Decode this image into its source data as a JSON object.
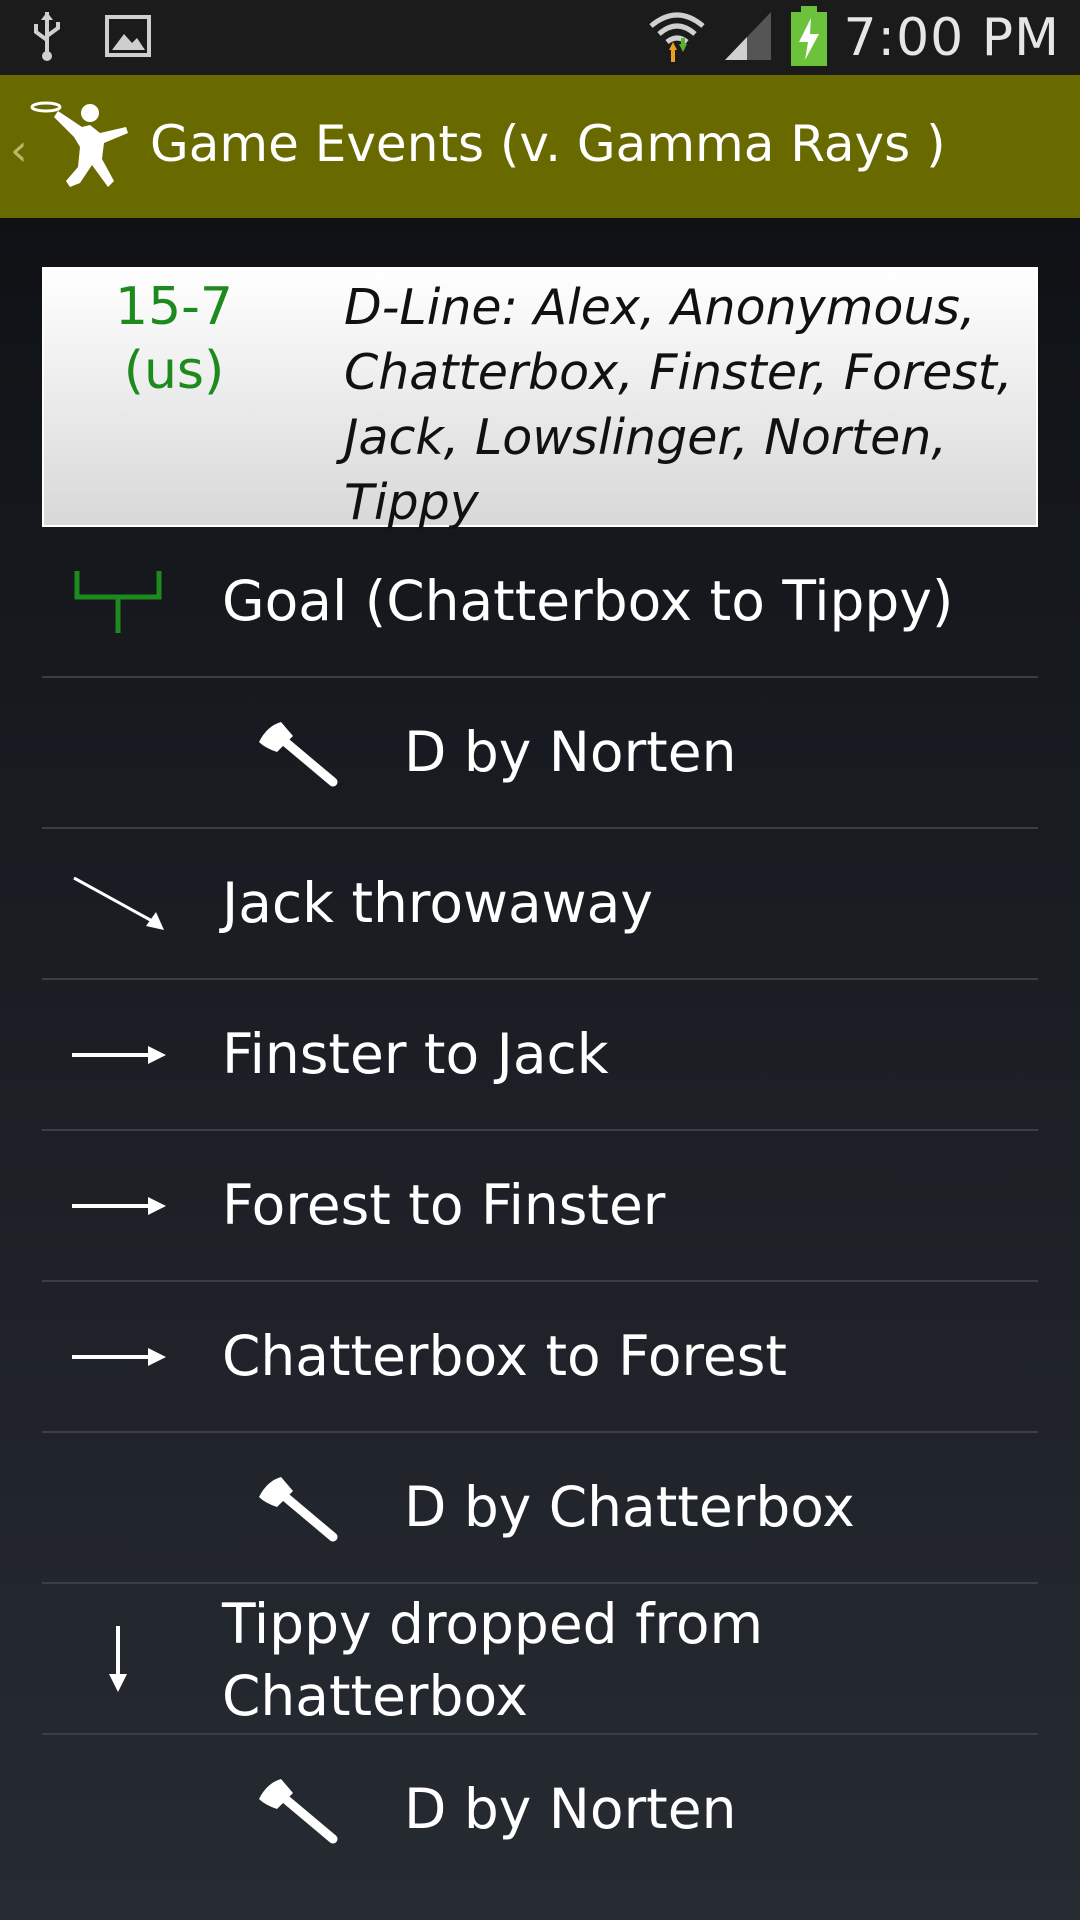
{
  "status_bar": {
    "time": "7:00 PM",
    "icons": [
      "usb-icon",
      "image-icon",
      "wifi-icon",
      "signal-icon",
      "battery-charging-icon"
    ]
  },
  "action_bar": {
    "title": "Game Events (v. Gamma Rays )",
    "icon": "ultimate-player-logo"
  },
  "score_card": {
    "score": "15-7",
    "score_side": "(us)",
    "line_text": "D-Line: Alex, Anonymous, Chatterbox, Finster, Forest, Jack, Lowslinger, Norten, Tippy"
  },
  "events": [
    {
      "text": "Goal (Chatterbox to Tippy)",
      "icon": "goal-icon"
    },
    {
      "text": "D by Norten",
      "icon": "axe-icon"
    },
    {
      "text": "Jack throwaway",
      "icon": "throwaway-arrow-icon"
    },
    {
      "text": "Finster to Jack",
      "icon": "pass-arrow-icon"
    },
    {
      "text": "Forest to Finster",
      "icon": "pass-arrow-icon"
    },
    {
      "text": "Chatterbox to Forest",
      "icon": "pass-arrow-icon"
    },
    {
      "text": "D by Chatterbox",
      "icon": "axe-icon"
    },
    {
      "text": "Tippy dropped from Chatterbox",
      "icon": "drop-arrow-icon"
    },
    {
      "text": "D by Norten",
      "icon": "axe-icon"
    }
  ],
  "colors": {
    "action_bar": "#686a00",
    "score": "#1d8a1d",
    "goal_icon": "#1d8a1d"
  }
}
